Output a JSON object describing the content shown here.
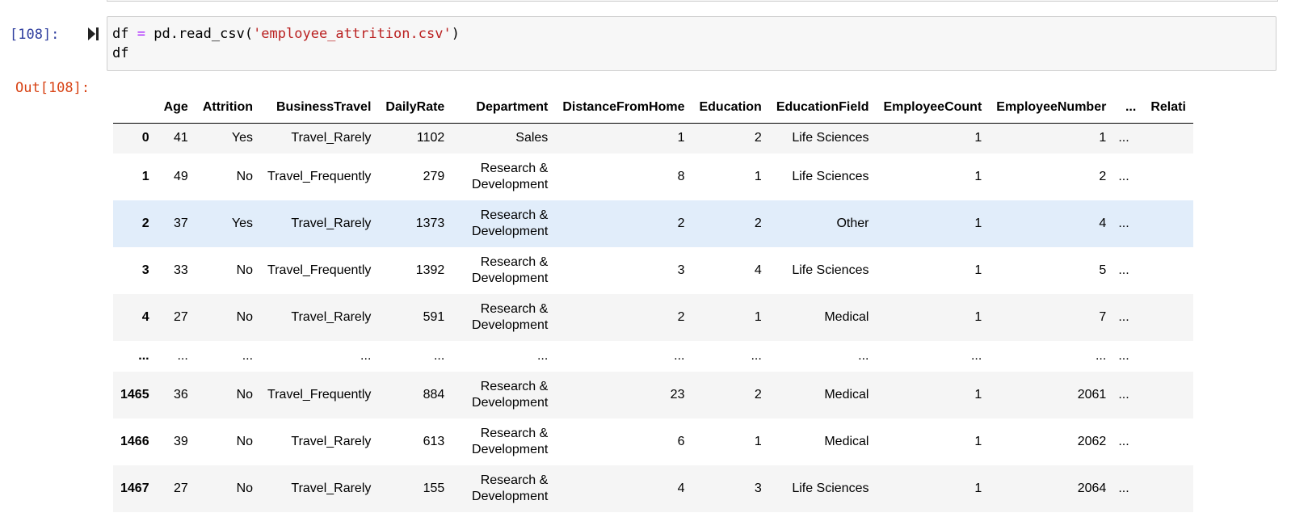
{
  "notebook": {
    "input_prompt": "[108]:",
    "output_prompt": "Out[108]:",
    "code_lines": [
      {
        "var": "df",
        "op": "=",
        "call_prefix": "pd.read_csv(",
        "string": "'employee_attrition.csv'",
        "call_suffix": ")"
      },
      {
        "text": "df"
      }
    ]
  },
  "table": {
    "columns": [
      "",
      "Age",
      "Attrition",
      "BusinessTravel",
      "DailyRate",
      "Department",
      "DistanceFromHome",
      "Education",
      "EducationField",
      "EmployeeCount",
      "EmployeeNumber",
      "...",
      "Relati"
    ],
    "rows": [
      {
        "index": "0",
        "cells": [
          "41",
          "Yes",
          "Travel_Rarely",
          "1102",
          "Sales",
          "1",
          "2",
          "Life Sciences",
          "1",
          "1",
          "...",
          ""
        ]
      },
      {
        "index": "1",
        "cells": [
          "49",
          "No",
          "Travel_Frequently",
          "279",
          "Research & Development",
          "8",
          "1",
          "Life Sciences",
          "1",
          "2",
          "...",
          ""
        ]
      },
      {
        "index": "2",
        "cells": [
          "37",
          "Yes",
          "Travel_Rarely",
          "1373",
          "Research & Development",
          "2",
          "2",
          "Other",
          "1",
          "4",
          "...",
          ""
        ]
      },
      {
        "index": "3",
        "cells": [
          "33",
          "No",
          "Travel_Frequently",
          "1392",
          "Research & Development",
          "3",
          "4",
          "Life Sciences",
          "1",
          "5",
          "...",
          ""
        ]
      },
      {
        "index": "4",
        "cells": [
          "27",
          "No",
          "Travel_Rarely",
          "591",
          "Research & Development",
          "2",
          "1",
          "Medical",
          "1",
          "7",
          "...",
          ""
        ]
      },
      {
        "index": "...",
        "cells": [
          "...",
          "...",
          "...",
          "...",
          "...",
          "...",
          "...",
          "...",
          "...",
          "...",
          "...",
          ""
        ]
      },
      {
        "index": "1465",
        "cells": [
          "36",
          "No",
          "Travel_Frequently",
          "884",
          "Research & Development",
          "23",
          "2",
          "Medical",
          "1",
          "2061",
          "...",
          ""
        ]
      },
      {
        "index": "1466",
        "cells": [
          "39",
          "No",
          "Travel_Rarely",
          "613",
          "Research & Development",
          "6",
          "1",
          "Medical",
          "1",
          "2062",
          "...",
          ""
        ]
      },
      {
        "index": "1467",
        "cells": [
          "27",
          "No",
          "Travel_Rarely",
          "155",
          "Research & Development",
          "4",
          "3",
          "Life Sciences",
          "1",
          "2064",
          "...",
          ""
        ]
      }
    ]
  },
  "colors": {
    "input_prompt": "#303f9f",
    "output_prompt": "#d84315",
    "keyword_operator": "#aa22ff",
    "string_literal": "#ba2121",
    "hover_row": "#e1edfa"
  },
  "icons": {
    "collapser": "collapse-toggle-icon"
  }
}
